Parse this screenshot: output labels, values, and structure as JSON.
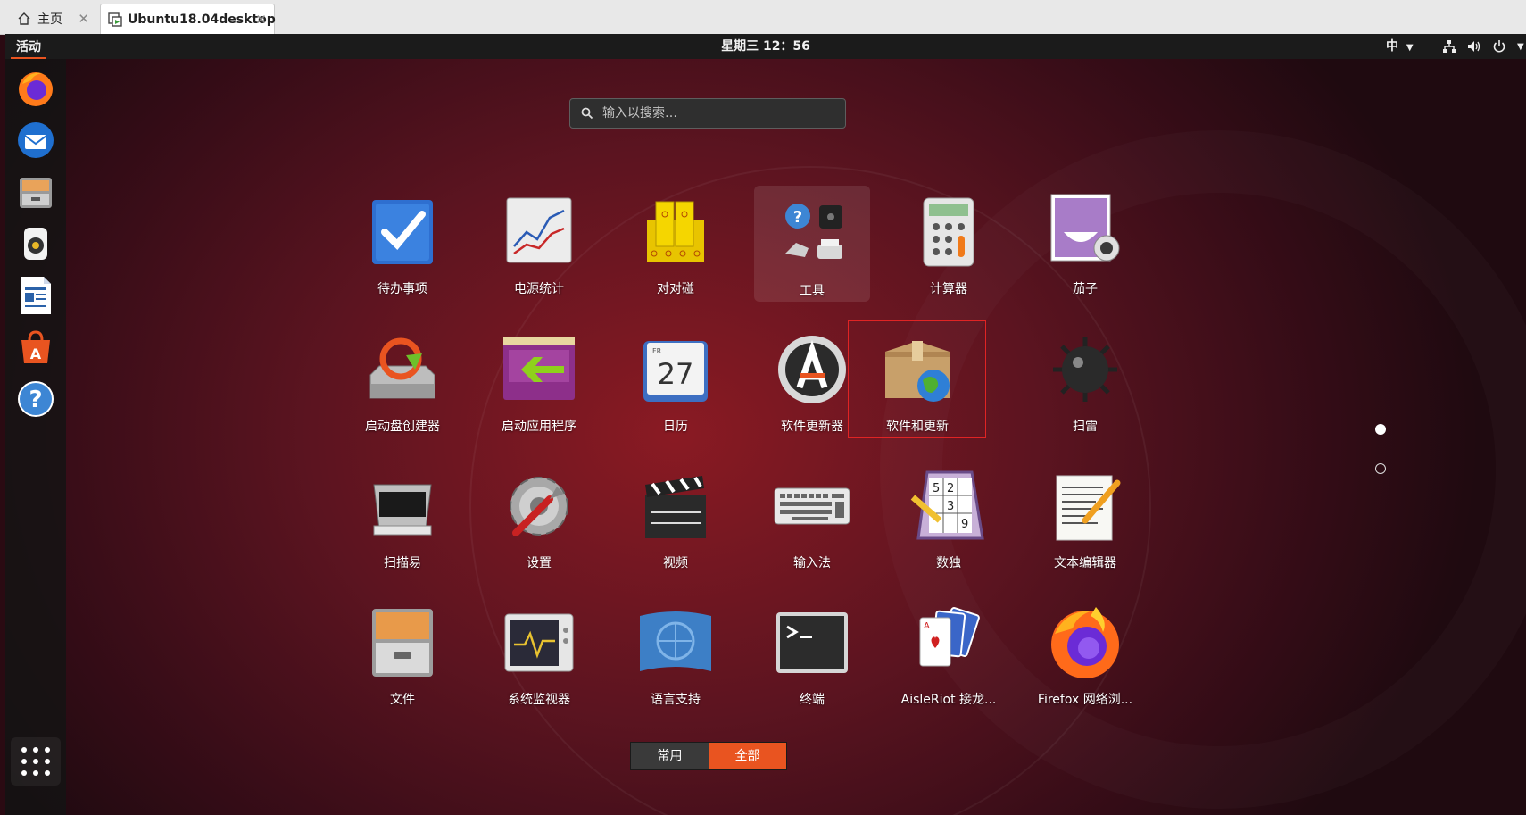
{
  "browser": {
    "tabs": [
      {
        "label": "主页"
      },
      {
        "label": "Ubuntu18.04desktop"
      }
    ]
  },
  "topbar": {
    "activities": "活动",
    "clock": "星期三 12：56",
    "input_method": "中"
  },
  "search": {
    "placeholder": "输入以搜索…"
  },
  "apps": [
    {
      "label": "待办事项",
      "icon": "todo-icon"
    },
    {
      "label": "电源统计",
      "icon": "power-statistics-icon"
    },
    {
      "label": "对对碰",
      "icon": "mahjongg-icon"
    },
    {
      "label": "工具",
      "icon": "utilities-folder-icon"
    },
    {
      "label": "计算器",
      "icon": "calculator-icon"
    },
    {
      "label": "茄子",
      "icon": "cheese-icon"
    },
    {
      "label": "启动盘创建器",
      "icon": "startup-disk-icon"
    },
    {
      "label": "启动应用程序",
      "icon": "startup-apps-icon"
    },
    {
      "label": "日历",
      "icon": "calendar-icon"
    },
    {
      "label": "软件更新器",
      "icon": "software-updater-icon"
    },
    {
      "label": "软件和更新",
      "icon": "software-properties-icon"
    },
    {
      "label": "扫雷",
      "icon": "mines-icon"
    },
    {
      "label": "扫描易",
      "icon": "scanner-icon"
    },
    {
      "label": "设置",
      "icon": "settings-icon"
    },
    {
      "label": "视频",
      "icon": "videos-icon"
    },
    {
      "label": "输入法",
      "icon": "keyboard-icon"
    },
    {
      "label": "数独",
      "icon": "sudoku-icon"
    },
    {
      "label": "文本编辑器",
      "icon": "text-editor-icon"
    },
    {
      "label": "文件",
      "icon": "files-icon"
    },
    {
      "label": "系统监视器",
      "icon": "system-monitor-icon"
    },
    {
      "label": "语言支持",
      "icon": "language-support-icon"
    },
    {
      "label": "终端",
      "icon": "terminal-icon"
    },
    {
      "label": "AisleRiot 接龙...",
      "icon": "aisleriot-icon"
    },
    {
      "label": "Firefox 网络浏...",
      "icon": "firefox-icon"
    }
  ],
  "calendar_icon": {
    "day": "FR",
    "date": "27"
  },
  "sudoku_digits": [
    "5",
    "2",
    "3",
    "9"
  ],
  "switcher": {
    "frequent": "常用",
    "all": "全部",
    "active": "全部"
  },
  "colors": {
    "accent": "#e95420",
    "selection_border": "#e02424"
  }
}
